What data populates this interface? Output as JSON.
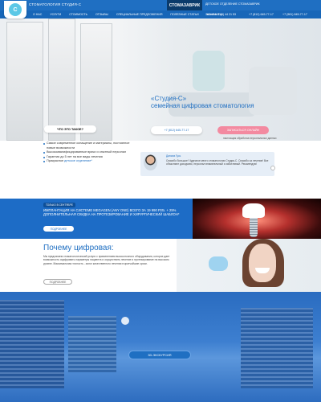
{
  "header": {
    "logo_letter": "С",
    "brand": "СТОМАТОЛОГИЯ СТУДИЯ-С",
    "partner": "СТОМАЗАВРИК",
    "partner_sub": "ДЕТСКОЕ ОТДЕЛЕНИЕ СТОМАЗАВРИК"
  },
  "nav": {
    "items": [
      "О НАС",
      "УСЛУГИ",
      "СТОИМОСТЬ",
      "ОТЗЫВЫ",
      "СПЕЦИАЛЬНЫЕ ПРЕДЛОЖЕНИЯ",
      "ПОЛЕЗНЫЕ СТАТЬИ",
      "КОНТАКТЫ"
    ],
    "phone1": "Звоните: 8 (4) 44 21 53",
    "phone2": "+7 (812) 645-77-17",
    "phone3": "+7 (981) 845-77-17"
  },
  "hero": {
    "title_line1": "«Студия-С»",
    "title_line2": "семейная цифровая стоматология",
    "btn_call": "+7 (812) 645-77-17",
    "btn_signup": "ЗАПИСАТЬСЯ ОНЛАЙН",
    "signup_note": "настоящая обработка персональных данных",
    "about": "ЧТО ЭТО ТАКОЕ?"
  },
  "features": {
    "items": [
      "Самое современное оснащение и материалы, постоянное новые возможности",
      "Высококвалифицированные врачи и опытный персонал",
      "Гарантия до 5 лет на все виды лечения",
      "Прикрасное детское отделение*"
    ],
    "link_text": "детское отделение*"
  },
  "review": {
    "name": "Данила Гусь",
    "text": "Спасибо большое! Чудесное место стоматологии Студия-С. Спасибо за лечение! Все объясняют доходчиво, персонал внимательный и заботливый. Рекомендую!"
  },
  "promo": {
    "tag": "ТОЛЬКО В СЕНТЯБРЕ",
    "title": "ИМПЛАНТАЦИЯ НА СИСТЕМЕ MEGAGEN (ANY ONE) ВСЕГО ЗА 19 990 РУБ. + 25% ДОПОЛНИТЕЛЬНАЯ СКИДКА НА ПРОТЕЗИРОВАНИЕ И ХИРУРГИЧЕСКИЙ ШАБЛОН*",
    "more": "ПОДРОБНЕЕ"
  },
  "why": {
    "title": "Почему цифровая:",
    "text": "Мы предлагаем стоматологический услуги с применением высокоточного оборудования, которое дает возможность оцифровать параметры пациента и осуществить лечение и протезирование на высоком уровне. Максимальная точность - залог качественного лечения в кратчайшие сроки.",
    "more": "ПОДРОБНЕЕ"
  },
  "tour": {
    "button": "3D-ЭКСКУРСИЯ"
  },
  "colors": {
    "primary": "#1f6fc2",
    "accent_pink": "#f38aa0",
    "promo_bg": "#1d6cc6"
  }
}
